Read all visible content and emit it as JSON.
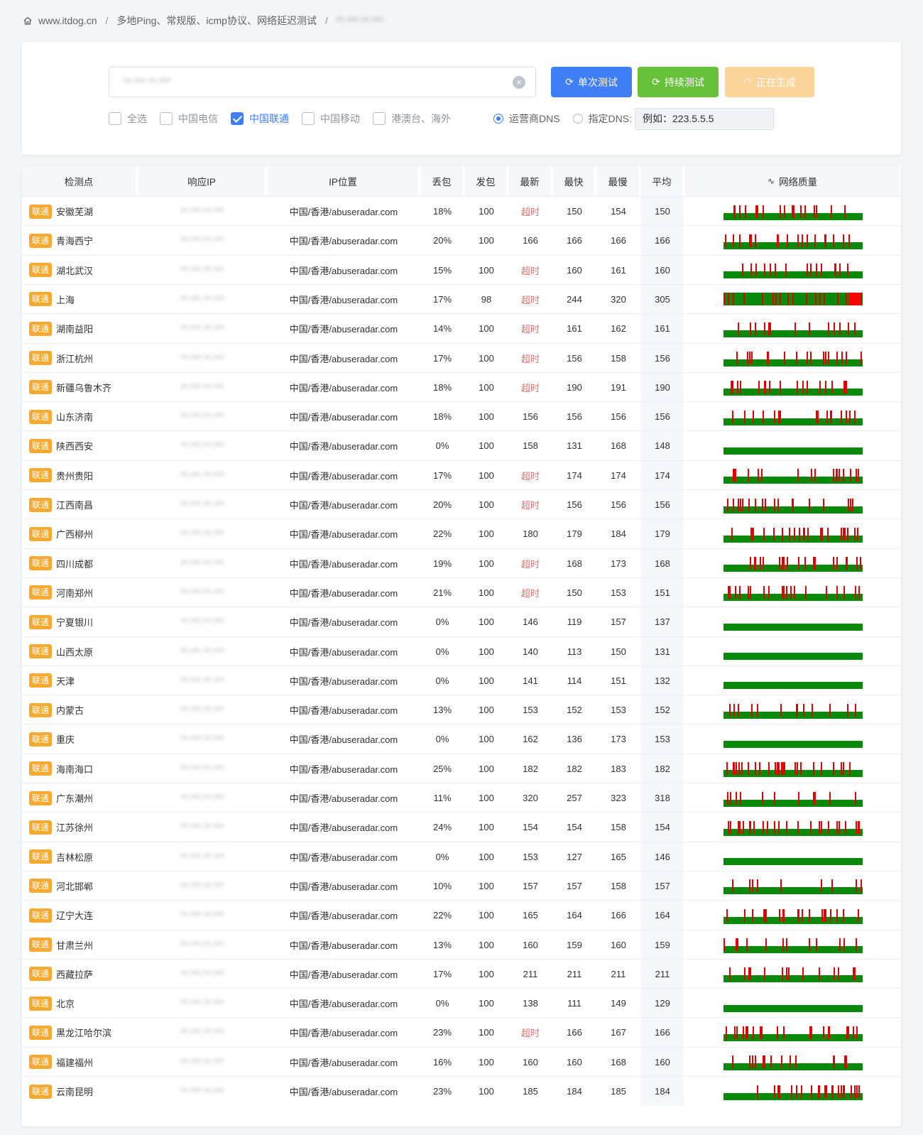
{
  "breadcrumb": {
    "home_icon": "home-icon",
    "site": "www.itdog.cn",
    "section": "多地Ping、常规版、icmp协议、网络延迟测试",
    "target": "**.***.**.***"
  },
  "controls": {
    "host_value": "**.***.**.***",
    "single_test_label": "单次测试",
    "continuous_test_label": "持续测试",
    "generating_label": "正在生成",
    "colors": {
      "primary": "#3e7ef7",
      "success": "#67c23a",
      "warning": "#fbd49b"
    },
    "isp_filters": [
      {
        "label": "全选",
        "checked": false
      },
      {
        "label": "中国电信",
        "checked": false
      },
      {
        "label": "中国联通",
        "checked": true
      },
      {
        "label": "中国移动",
        "checked": false
      },
      {
        "label": "港澳台、海外",
        "checked": false
      }
    ],
    "dns_options": [
      {
        "label": "运营商DNS",
        "checked": true
      },
      {
        "label": "指定DNS:",
        "checked": false
      }
    ],
    "dns_placeholder": "例如：223.5.5.5"
  },
  "table": {
    "headers": [
      "检测点",
      "响应IP",
      "IP位置",
      "丢包",
      "发包",
      "最新",
      "最快",
      "最慢",
      "平均",
      "网络质量"
    ],
    "isp_badge": "联通",
    "location": "中国/香港/abuseradar.com",
    "timeout_label": "超时",
    "rows": [
      {
        "node": "安徽芜湖",
        "ip": "**.***.**.***",
        "loss": "18%",
        "sent": "100",
        "latest": "超时",
        "fastest": "150",
        "slowest": "154",
        "avg": "150",
        "q": 0.18,
        "spike": false
      },
      {
        "node": "青海西宁",
        "ip": "**.***.**.***",
        "loss": "20%",
        "sent": "100",
        "latest": "166",
        "fastest": "166",
        "slowest": "166",
        "avg": "166",
        "q": 0.2,
        "spike": false
      },
      {
        "node": "湖北武汉",
        "ip": "**.***.**.***",
        "loss": "15%",
        "sent": "100",
        "latest": "超时",
        "fastest": "160",
        "slowest": "161",
        "avg": "160",
        "q": 0.15,
        "spike": false
      },
      {
        "node": "上海",
        "ip": "**.***.**.***",
        "loss": "17%",
        "sent": "98",
        "latest": "超时",
        "fastest": "244",
        "slowest": "320",
        "avg": "305",
        "q": 0.17,
        "spike": true
      },
      {
        "node": "湖南益阳",
        "ip": "**.***.**.***",
        "loss": "14%",
        "sent": "100",
        "latest": "超时",
        "fastest": "161",
        "slowest": "162",
        "avg": "161",
        "q": 0.14,
        "spike": false
      },
      {
        "node": "浙江杭州",
        "ip": "**.***.**.***",
        "loss": "17%",
        "sent": "100",
        "latest": "超时",
        "fastest": "156",
        "slowest": "158",
        "avg": "156",
        "q": 0.17,
        "spike": false
      },
      {
        "node": "新疆乌鲁木齐",
        "ip": "**.***.**.***",
        "loss": "18%",
        "sent": "100",
        "latest": "超时",
        "fastest": "190",
        "slowest": "191",
        "avg": "190",
        "q": 0.18,
        "spike": false
      },
      {
        "node": "山东济南",
        "ip": "**.***.**.***",
        "loss": "18%",
        "sent": "100",
        "latest": "156",
        "fastest": "156",
        "slowest": "156",
        "avg": "156",
        "q": 0.18,
        "spike": false
      },
      {
        "node": "陕西西安",
        "ip": "**.***.**.***",
        "loss": "0%",
        "sent": "100",
        "latest": "158",
        "fastest": "131",
        "slowest": "168",
        "avg": "148",
        "q": 0,
        "spike": false
      },
      {
        "node": "贵州贵阳",
        "ip": "**.***.**.***",
        "loss": "17%",
        "sent": "100",
        "latest": "超时",
        "fastest": "174",
        "slowest": "174",
        "avg": "174",
        "q": 0.17,
        "spike": false
      },
      {
        "node": "江西南昌",
        "ip": "**.***.**.***",
        "loss": "20%",
        "sent": "100",
        "latest": "超时",
        "fastest": "156",
        "slowest": "156",
        "avg": "156",
        "q": 0.2,
        "spike": false
      },
      {
        "node": "广西柳州",
        "ip": "**.***.**.***",
        "loss": "22%",
        "sent": "100",
        "latest": "180",
        "fastest": "179",
        "slowest": "184",
        "avg": "179",
        "q": 0.22,
        "spike": false
      },
      {
        "node": "四川成都",
        "ip": "**.***.**.***",
        "loss": "19%",
        "sent": "100",
        "latest": "超时",
        "fastest": "168",
        "slowest": "173",
        "avg": "168",
        "q": 0.19,
        "spike": false
      },
      {
        "node": "河南郑州",
        "ip": "**.***.**.***",
        "loss": "21%",
        "sent": "100",
        "latest": "超时",
        "fastest": "150",
        "slowest": "153",
        "avg": "151",
        "q": 0.21,
        "spike": false
      },
      {
        "node": "宁夏银川",
        "ip": "**.***.**.***",
        "loss": "0%",
        "sent": "100",
        "latest": "146",
        "fastest": "119",
        "slowest": "157",
        "avg": "137",
        "q": 0,
        "spike": false
      },
      {
        "node": "山西太原",
        "ip": "**.***.**.***",
        "loss": "0%",
        "sent": "100",
        "latest": "140",
        "fastest": "113",
        "slowest": "150",
        "avg": "131",
        "q": 0,
        "spike": false
      },
      {
        "node": "天津",
        "ip": "**.***.**.***",
        "loss": "0%",
        "sent": "100",
        "latest": "141",
        "fastest": "114",
        "slowest": "151",
        "avg": "132",
        "q": 0,
        "spike": false
      },
      {
        "node": "内蒙古",
        "ip": "**.***.**.***",
        "loss": "13%",
        "sent": "100",
        "latest": "153",
        "fastest": "152",
        "slowest": "153",
        "avg": "152",
        "q": 0.13,
        "spike": false
      },
      {
        "node": "重庆",
        "ip": "**.***.**.***",
        "loss": "0%",
        "sent": "100",
        "latest": "162",
        "fastest": "136",
        "slowest": "173",
        "avg": "153",
        "q": 0,
        "spike": false
      },
      {
        "node": "海南海口",
        "ip": "**.***.**.***",
        "loss": "25%",
        "sent": "100",
        "latest": "182",
        "fastest": "182",
        "slowest": "183",
        "avg": "182",
        "q": 0.25,
        "spike": false
      },
      {
        "node": "广东潮州",
        "ip": "**.***.**.***",
        "loss": "11%",
        "sent": "100",
        "latest": "320",
        "fastest": "257",
        "slowest": "323",
        "avg": "318",
        "q": 0.11,
        "spike": false
      },
      {
        "node": "江苏徐州",
        "ip": "**.***.**.***",
        "loss": "24%",
        "sent": "100",
        "latest": "154",
        "fastest": "154",
        "slowest": "158",
        "avg": "154",
        "q": 0.24,
        "spike": false
      },
      {
        "node": "吉林松原",
        "ip": "**.***.**.***",
        "loss": "0%",
        "sent": "100",
        "latest": "153",
        "fastest": "127",
        "slowest": "165",
        "avg": "146",
        "q": 0,
        "spike": false
      },
      {
        "node": "河北邯郸",
        "ip": "**.***.**.***",
        "loss": "10%",
        "sent": "100",
        "latest": "157",
        "fastest": "157",
        "slowest": "158",
        "avg": "157",
        "q": 0.1,
        "spike": false
      },
      {
        "node": "辽宁大连",
        "ip": "**.***.**.***",
        "loss": "22%",
        "sent": "100",
        "latest": "165",
        "fastest": "164",
        "slowest": "166",
        "avg": "164",
        "q": 0.22,
        "spike": false
      },
      {
        "node": "甘肃兰州",
        "ip": "**.***.**.***",
        "loss": "13%",
        "sent": "100",
        "latest": "160",
        "fastest": "159",
        "slowest": "160",
        "avg": "159",
        "q": 0.13,
        "spike": false
      },
      {
        "node": "西藏拉萨",
        "ip": "**.***.**.***",
        "loss": "17%",
        "sent": "100",
        "latest": "211",
        "fastest": "211",
        "slowest": "211",
        "avg": "211",
        "q": 0.17,
        "spike": false
      },
      {
        "node": "北京",
        "ip": "**.***.**.***",
        "loss": "0%",
        "sent": "100",
        "latest": "138",
        "fastest": "111",
        "slowest": "149",
        "avg": "129",
        "q": 0,
        "spike": false
      },
      {
        "node": "黑龙江哈尔滨",
        "ip": "**.***.**.***",
        "loss": "23%",
        "sent": "100",
        "latest": "超时",
        "fastest": "166",
        "slowest": "167",
        "avg": "166",
        "q": 0.23,
        "spike": false
      },
      {
        "node": "福建福州",
        "ip": "**.***.**.***",
        "loss": "16%",
        "sent": "100",
        "latest": "160",
        "fastest": "160",
        "slowest": "168",
        "avg": "160",
        "q": 0.16,
        "spike": false
      },
      {
        "node": "云南昆明",
        "ip": "**.***.**.***",
        "loss": "23%",
        "sent": "100",
        "latest": "185",
        "fastest": "184",
        "slowest": "185",
        "avg": "184",
        "q": 0.23,
        "spike": false
      }
    ]
  }
}
